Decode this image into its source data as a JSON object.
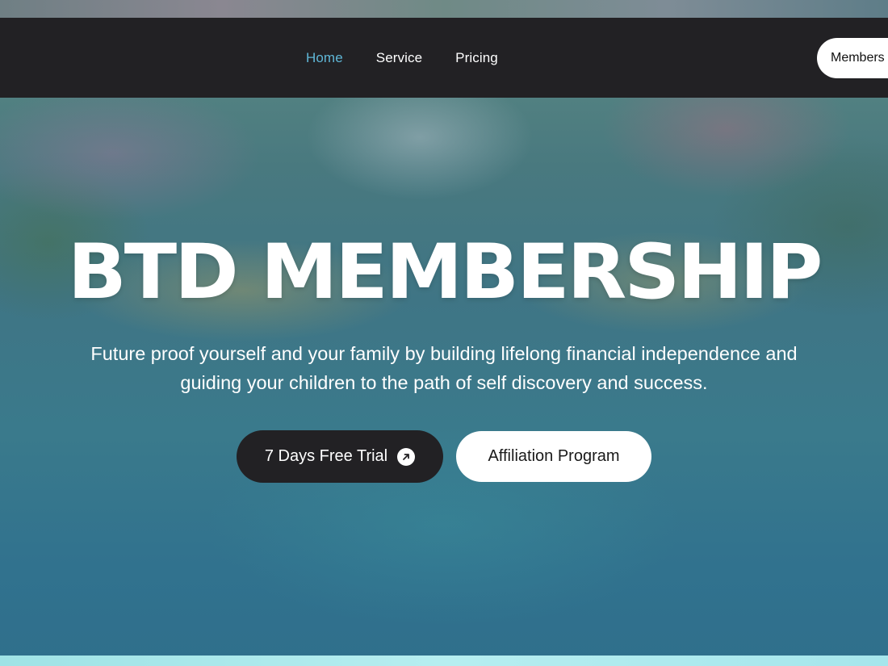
{
  "nav": {
    "links": [
      {
        "label": "Home",
        "active": true
      },
      {
        "label": "Service",
        "active": false
      },
      {
        "label": "Pricing",
        "active": false
      }
    ],
    "member_button": "Members"
  },
  "hero": {
    "title": "BTD MEMBERSHIP",
    "subtitle_line1": "Future proof yourself and your family by building lifelong financial independence and",
    "subtitle_line2": "guiding your children to the path of self discovery and success.",
    "primary_button": "7 Days Free Trial",
    "primary_button_icon": "arrow-up-right-circle-icon",
    "secondary_button": "Affiliation Program"
  },
  "colors": {
    "navbar_bg": "#222124",
    "active_link": "#5fb6d6",
    "button_dark": "#222124",
    "button_light": "#ffffff"
  }
}
